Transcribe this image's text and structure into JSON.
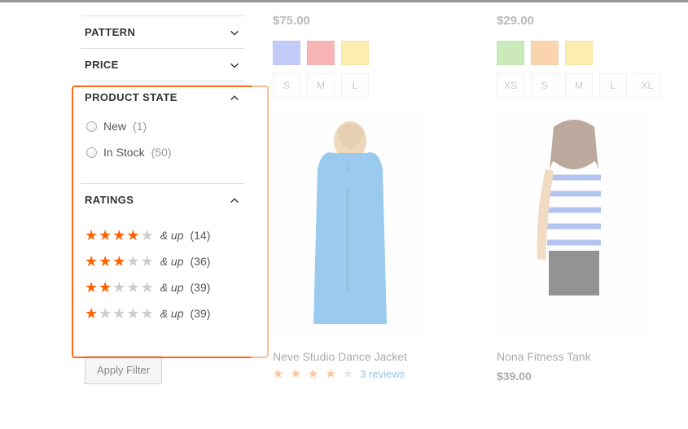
{
  "filters": {
    "pattern": {
      "title": "PATTERN"
    },
    "price": {
      "title": "PRICE"
    },
    "product_state": {
      "title": "PRODUCT STATE",
      "options": [
        {
          "label": "New",
          "count": "(1)"
        },
        {
          "label": "In Stock",
          "count": "(50)"
        }
      ]
    },
    "ratings": {
      "title": "RATINGS",
      "and_up": "& up",
      "rows": [
        {
          "filled": 4,
          "count": "(14)"
        },
        {
          "filled": 3,
          "count": "(36)"
        },
        {
          "filled": 2,
          "count": "(39)"
        },
        {
          "filled": 1,
          "count": "(39)"
        }
      ]
    },
    "apply_label": "Apply Filter"
  },
  "products": [
    {
      "price": "$75.00",
      "colors": [
        "#7a8ef0",
        "#f05c5c",
        "#f7d94c"
      ],
      "sizes": [
        "S",
        "M",
        "L"
      ],
      "name": "Neve Studio Dance Jacket",
      "rating_filled": 4,
      "reviews_label": "3 reviews"
    },
    {
      "price": "$29.00",
      "colors": [
        "#8bd16b",
        "#f2a04e",
        "#f7d94c"
      ],
      "sizes": [
        "XS",
        "S",
        "M",
        "L",
        "XL"
      ],
      "name": "Nona Fitness Tank",
      "price2": "$39.00"
    }
  ]
}
